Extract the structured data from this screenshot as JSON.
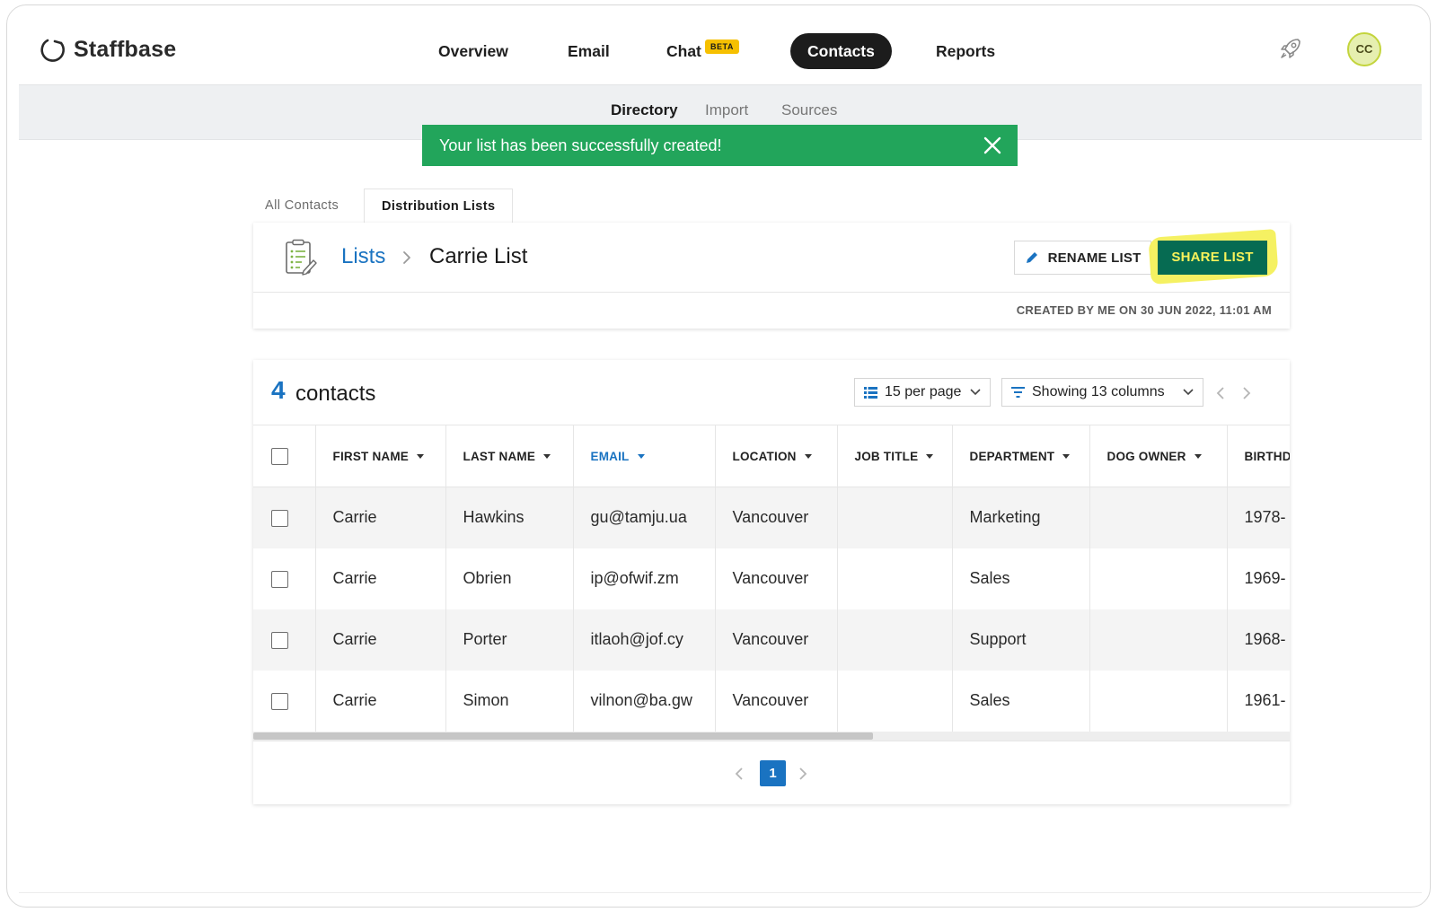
{
  "app": {
    "name": "Staffbase"
  },
  "nav": {
    "items": [
      {
        "label": "Overview"
      },
      {
        "label": "Email"
      },
      {
        "label": "Chat",
        "badge": "BETA"
      },
      {
        "label": "Contacts",
        "active": true
      },
      {
        "label": "Reports"
      }
    ]
  },
  "user": {
    "initials": "CC"
  },
  "subnav": {
    "items": [
      {
        "label": "Directory",
        "active": true
      },
      {
        "label": "Import"
      },
      {
        "label": "Sources"
      }
    ]
  },
  "toast": {
    "message": "Your list has been successfully created!"
  },
  "tabs": [
    {
      "label": "All Contacts"
    },
    {
      "label": "Distribution Lists",
      "active": true
    }
  ],
  "list": {
    "breadcrumb_root": "Lists",
    "name": "Carrie List",
    "rename_label": "RENAME LIST",
    "share_label": "SHARE LIST",
    "created": "CREATED BY ME ON 30 JUN 2022, 11:01 AM"
  },
  "contacts": {
    "count": "4",
    "count_label": "contacts",
    "per_page": "15 per page",
    "columns_shown": "Showing 13 columns",
    "headers": [
      "FIRST NAME",
      "LAST NAME",
      "EMAIL",
      "LOCATION",
      "JOB TITLE",
      "DEPARTMENT",
      "DOG OWNER",
      "BIRTHDA"
    ],
    "rows": [
      {
        "first": "Carrie",
        "last": "Hawkins",
        "email": "gu@tamju.ua",
        "location": "Vancouver",
        "job": "",
        "department": "Marketing",
        "dog": "",
        "birth": "1978-"
      },
      {
        "first": "Carrie",
        "last": "Obrien",
        "email": "ip@ofwif.zm",
        "location": "Vancouver",
        "job": "",
        "department": "Sales",
        "dog": "",
        "birth": "1969-"
      },
      {
        "first": "Carrie",
        "last": "Porter",
        "email": "itlaoh@jof.cy",
        "location": "Vancouver",
        "job": "",
        "department": "Support",
        "dog": "",
        "birth": "1968-"
      },
      {
        "first": "Carrie",
        "last": "Simon",
        "email": "vilnon@ba.gw",
        "location": "Vancouver",
        "job": "",
        "department": "Sales",
        "dog": "",
        "birth": "1961-"
      }
    ],
    "page": "1"
  },
  "colors": {
    "accent": "#1a73c1",
    "success": "#22a55b",
    "share_bg": "#066b52",
    "highlight": "#f4f05a",
    "beta": "#f6c000"
  }
}
